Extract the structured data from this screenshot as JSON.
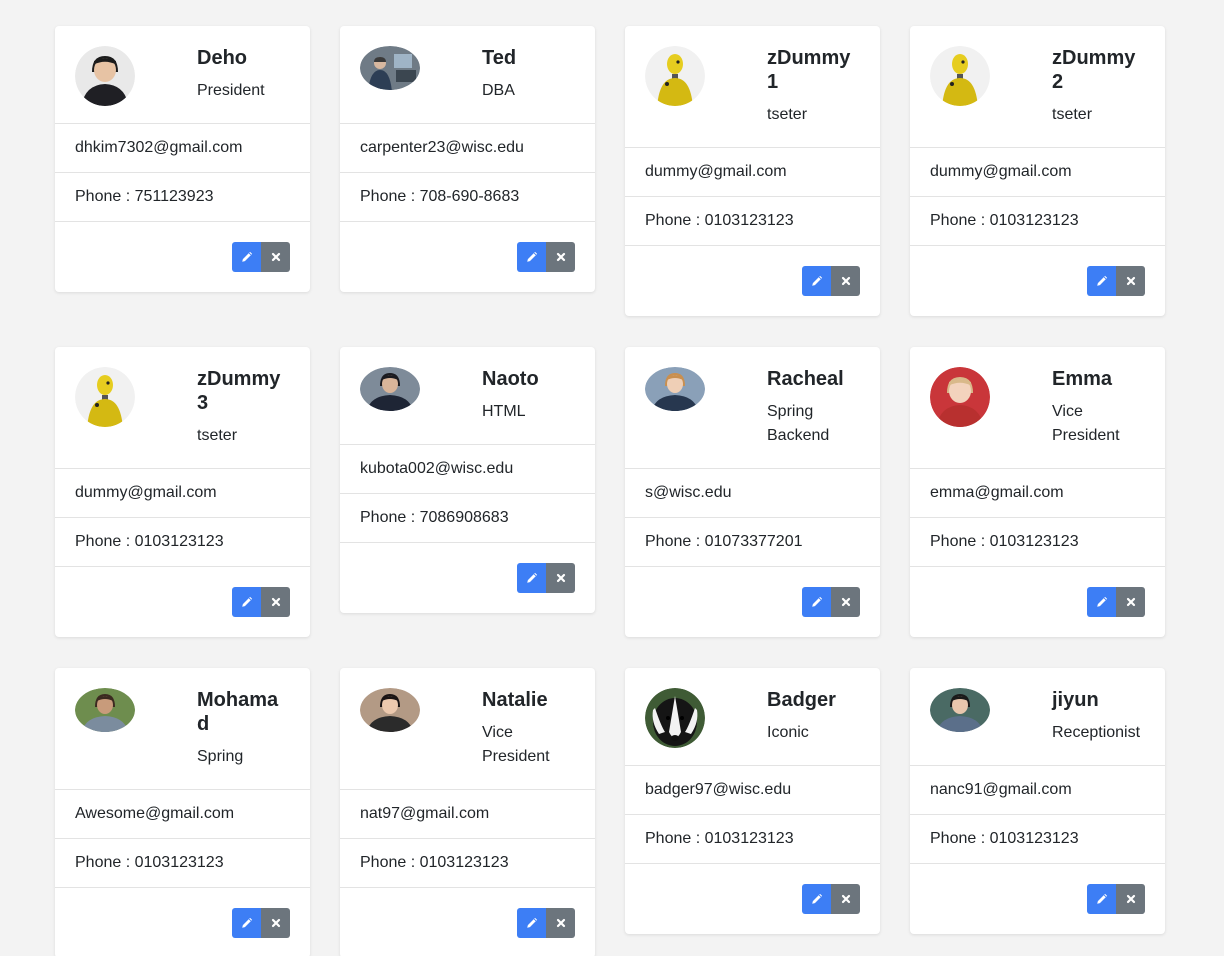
{
  "theme": {
    "page_background": "#f3f3f3",
    "card_background": "#ffffff",
    "edit_button": "#3d7ef5",
    "delete_button": "#6c757d",
    "divider": "#e3e3e3"
  },
  "icons": {
    "edit": "pencil-icon",
    "delete": "close-icon"
  },
  "employees": [
    {
      "name": "Deho",
      "role": "President",
      "email": "dhkim7302@gmail.com",
      "phone": "Phone : 751123923",
      "avatar": {
        "shape": "circle",
        "kind": "person",
        "bg": "#e9e9e9",
        "skin": "#e7c3a4",
        "hair": "#1c1c1c",
        "clothes": "#1f1f24"
      }
    },
    {
      "name": "Ted",
      "role": "DBA",
      "email": "carpenter23@wisc.edu",
      "phone": "Phone : 708-690-8683",
      "avatar": {
        "shape": "oval",
        "kind": "office",
        "bg": "#6f7b86",
        "skin": "#d7b8a0",
        "hair": "#3a3a3a",
        "clothes": "#2d3e55"
      }
    },
    {
      "name": "zDummy1",
      "role": "tseter",
      "email": "dummy@gmail.com",
      "phone": "Phone : 0103123123",
      "avatar": {
        "shape": "circle",
        "kind": "dummy",
        "bg": "#f1f1f1",
        "skin": "#e6cd1f",
        "hair": "#e6cd1f",
        "clothes": "#d4b912"
      }
    },
    {
      "name": "zDummy2",
      "role": "tseter",
      "email": "dummy@gmail.com",
      "phone": "Phone : 0103123123",
      "avatar": {
        "shape": "circle",
        "kind": "dummy",
        "bg": "#f1f1f1",
        "skin": "#e6cd1f",
        "hair": "#e6cd1f",
        "clothes": "#d4b912"
      }
    },
    {
      "name": "zDummy3",
      "role": "tseter",
      "email": "dummy@gmail.com",
      "phone": "Phone : 0103123123",
      "avatar": {
        "shape": "circle",
        "kind": "dummy",
        "bg": "#f1f1f1",
        "skin": "#e6cd1f",
        "hair": "#e6cd1f",
        "clothes": "#d4b912"
      }
    },
    {
      "name": "Naoto",
      "role": "HTML",
      "email": "kubota002@wisc.edu",
      "phone": "Phone : 7086908683",
      "avatar": {
        "shape": "oval",
        "kind": "person",
        "bg": "#7e8b99",
        "skin": "#d9b59a",
        "hair": "#1b1b20",
        "clothes": "#1e2535"
      }
    },
    {
      "name": "Racheal",
      "role": "Spring Backend",
      "email": "s@wisc.edu",
      "phone": "Phone : 01073377201",
      "avatar": {
        "shape": "oval",
        "kind": "person",
        "bg": "#8aa0b8",
        "skin": "#efcfb6",
        "hair": "#c98f4f",
        "clothes": "#27374f"
      }
    },
    {
      "name": "Emma",
      "role": "Vice President",
      "email": "emma@gmail.com",
      "phone": "Phone : 0103123123",
      "avatar": {
        "shape": "circle",
        "kind": "person",
        "bg": "#c9363a",
        "skin": "#f3d3bd",
        "hair": "#d9b98a",
        "clothes": "#b8302f"
      }
    },
    {
      "name": "Mohamad",
      "role": "Spring",
      "email": "Awesome@gmail.com",
      "phone": "Phone : 0103123123",
      "avatar": {
        "shape": "oval",
        "kind": "person",
        "bg": "#6e8d4e",
        "skin": "#c89b7b",
        "hair": "#3b2a20",
        "clothes": "#7b8c9e"
      }
    },
    {
      "name": "Natalie",
      "role": "Vice President",
      "email": "nat97@gmail.com",
      "phone": "Phone : 0103123123",
      "avatar": {
        "shape": "oval",
        "kind": "person",
        "bg": "#b39a85",
        "skin": "#edc9ae",
        "hair": "#1a1414",
        "clothes": "#2b2b2b"
      }
    },
    {
      "name": "Badger",
      "role": "Iconic",
      "email": "badger97@wisc.edu",
      "phone": "Phone : 0103123123",
      "avatar": {
        "shape": "circle",
        "kind": "badger",
        "bg": "#3f5b35",
        "skin": "#f2f2f2",
        "hair": "#151515",
        "clothes": "#151515"
      }
    },
    {
      "name": "jiyun",
      "role": "Receptionist",
      "email": "nanc91@gmail.com",
      "phone": "Phone : 0103123123",
      "avatar": {
        "shape": "oval",
        "kind": "person",
        "bg": "#4a6a64",
        "skin": "#e8c6ad",
        "hair": "#1a1a1a",
        "clothes": "#5b6f8a"
      }
    }
  ]
}
